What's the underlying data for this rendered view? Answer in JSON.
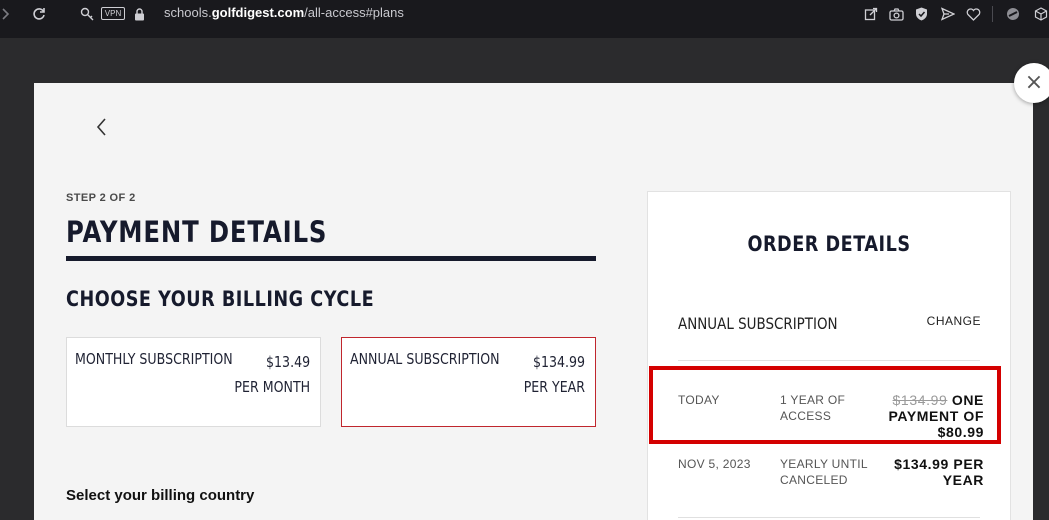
{
  "browser": {
    "url_prefix": "schools.",
    "url_domain": "golfdigest.com",
    "url_path": "/all-access#plans",
    "vpn_label": "VPN"
  },
  "modal": {
    "step_label": "STEP 2 OF 2",
    "title": "PAYMENT DETAILS",
    "billing_heading": "CHOOSE YOUR BILLING CYCLE",
    "plans": [
      {
        "name": "MONTHLY SUBSCRIPTION",
        "price": "$13.49",
        "period": "PER MONTH",
        "selected": false
      },
      {
        "name": "ANNUAL SUBSCRIPTION",
        "price": "$134.99",
        "period": "PER YEAR",
        "selected": true
      }
    ],
    "country_label": "Select your billing country"
  },
  "order": {
    "title": "ORDER DETAILS",
    "subscription_name": "ANNUAL SUBSCRIPTION",
    "change_label": "CHANGE",
    "rows": [
      {
        "date": "TODAY",
        "term_line1": "1 YEAR OF",
        "term_line2": "ACCESS",
        "original_price": "$134.99",
        "amount_line1": "ONE",
        "amount_line2": "PAYMENT OF",
        "amount_line3": "$80.99"
      },
      {
        "date": "NOV 5, 2023",
        "term_line1": "YEARLY UNTIL",
        "term_line2": "CANCELED",
        "amount_line1": "$134.99 PER",
        "amount_line2": "YEAR"
      }
    ]
  },
  "colors": {
    "navy": "#161a2c",
    "selected_border": "#c0262d",
    "highlight": "#d40000"
  }
}
